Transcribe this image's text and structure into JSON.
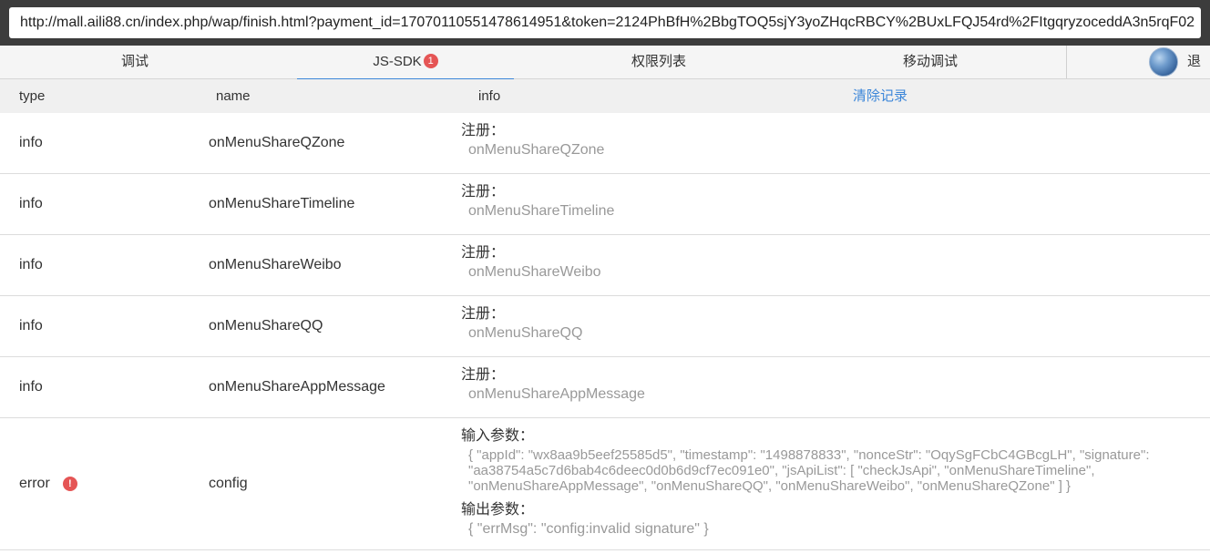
{
  "browser": {
    "url": "http://mall.aili88.cn/index.php/wap/finish.html?payment_id=17070110551478614951&token=2124PhBfH%2BbgTOQ5sjY3yoZHqcRBCY%2BUxLFQJ54rd%2FItgqryzoceddA3n5rqF02"
  },
  "tabs": [
    {
      "label": "调试"
    },
    {
      "label": "JS-SDK",
      "badge": "1"
    },
    {
      "label": "权限列表"
    },
    {
      "label": "移动调试"
    }
  ],
  "user": {
    "label": "退"
  },
  "table": {
    "headers": {
      "type": "type",
      "name": "name",
      "info": "info",
      "clear": "清除记录"
    },
    "rows": [
      {
        "type": "info",
        "name": "onMenuShareQZone",
        "info_label": "注册：",
        "info_value": "onMenuShareQZone"
      },
      {
        "type": "info",
        "name": "onMenuShareTimeline",
        "info_label": "注册：",
        "info_value": "onMenuShareTimeline"
      },
      {
        "type": "info",
        "name": "onMenuShareWeibo",
        "info_label": "注册：",
        "info_value": "onMenuShareWeibo"
      },
      {
        "type": "info",
        "name": "onMenuShareQQ",
        "info_label": "注册：",
        "info_value": "onMenuShareQQ"
      },
      {
        "type": "info",
        "name": "onMenuShareAppMessage",
        "info_label": "注册：",
        "info_value": "onMenuShareAppMessage"
      }
    ],
    "error_row": {
      "type": "error",
      "error_icon": "!",
      "name": "config",
      "input_label": "输入参数：",
      "input_line1": "{ \"appId\": \"wx8aa9b5eef25585d5\", \"timestamp\": \"1498878833\", \"nonceStr\": \"OqySgFCbC4GBcgLH\", \"signature\":",
      "input_line2": "\"aa38754a5c7d6bab4c6deec0d0b6d9cf7ec091e0\", \"jsApiList\": [ \"checkJsApi\", \"onMenuShareTimeline\",",
      "input_line3": "\"onMenuShareAppMessage\", \"onMenuShareQQ\", \"onMenuShareWeibo\", \"onMenuShareQZone\" ] }",
      "output_label": "输出参数：",
      "output_value": "{ \"errMsg\": \"config:invalid signature\" }"
    }
  }
}
